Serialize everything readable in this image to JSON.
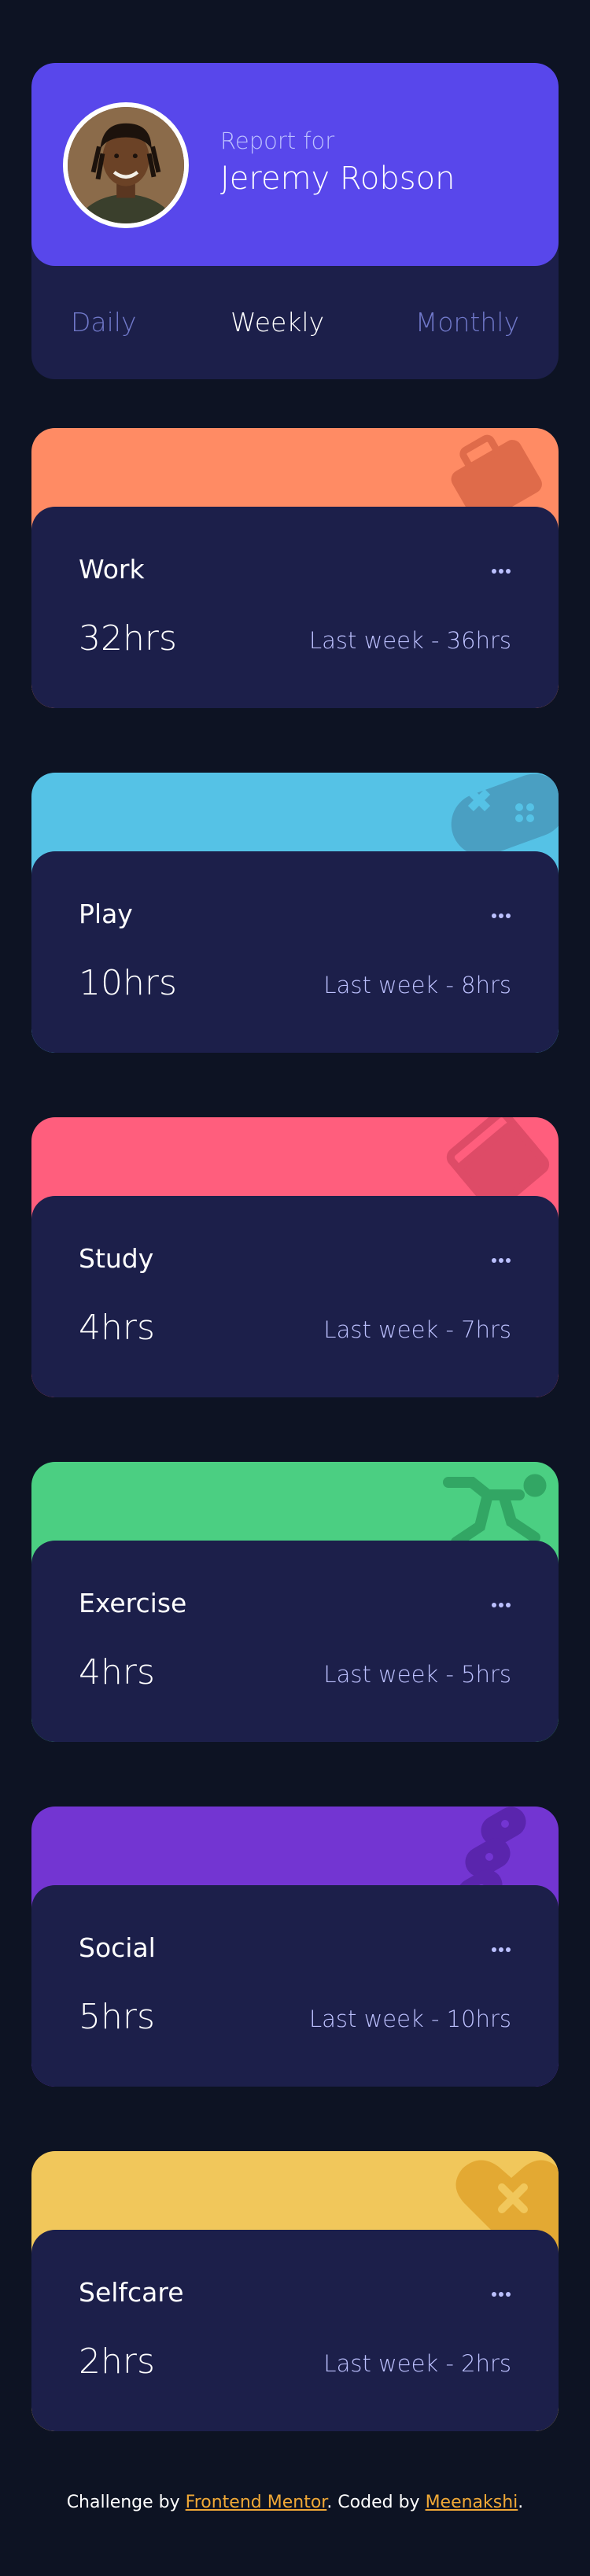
{
  "profile": {
    "report_for": "Report for",
    "name": "Jeremy Robson",
    "periods": [
      "Daily",
      "Weekly",
      "Monthly"
    ],
    "active_period": "Weekly"
  },
  "activities": [
    {
      "title": "Work",
      "current": "32hrs",
      "previous": "Last week - 36hrs",
      "color": "#ff8b64",
      "icon": "briefcase-icon",
      "icon_color": "#df6b4a"
    },
    {
      "title": "Play",
      "current": "10hrs",
      "previous": "Last week - 8hrs",
      "color": "#55c2e6",
      "icon": "gamepad-icon",
      "icon_color": "#4a9fc2"
    },
    {
      "title": "Study",
      "current": "4hrs",
      "previous": "Last week - 7hrs",
      "color": "#ff5e7d",
      "icon": "book-icon",
      "icon_color": "#de4b67"
    },
    {
      "title": "Exercise",
      "current": "4hrs",
      "previous": "Last week - 5hrs",
      "color": "#4bcf82",
      "icon": "running-icon",
      "icon_color": "#32a664"
    },
    {
      "title": "Social",
      "current": "5hrs",
      "previous": "Last week - 10hrs",
      "color": "#7335d2",
      "icon": "social-icon",
      "icon_color": "#5a25ad"
    },
    {
      "title": "Selfcare",
      "current": "2hrs",
      "previous": "Last week - 2hrs",
      "color": "#f1c75b",
      "icon": "heart-icon",
      "icon_color": "#e3a933"
    }
  ],
  "footer": {
    "prefix": "Challenge by ",
    "link1": "Frontend Mentor",
    "middle": ". Coded by ",
    "link2": "Meenakshi",
    "suffix": "."
  },
  "colors": {
    "background": "#0d1323",
    "card": "#1c1f4a",
    "accent": "#5847eb",
    "link": "#f0a836"
  }
}
